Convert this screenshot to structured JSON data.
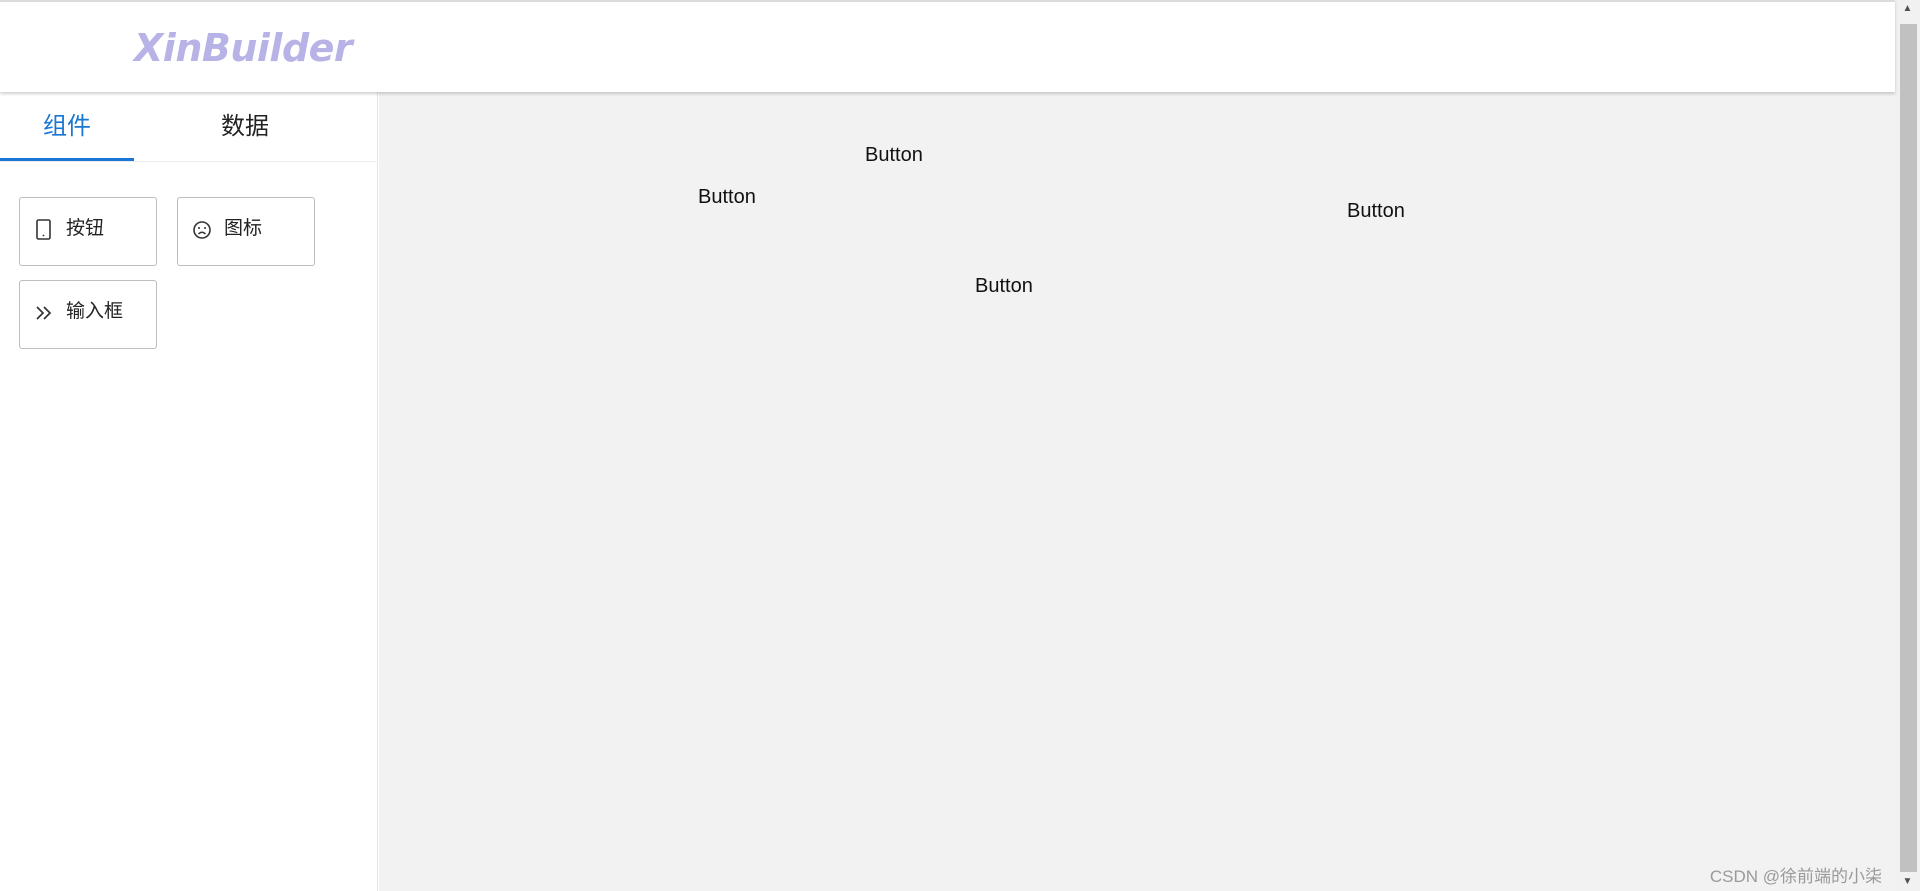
{
  "header": {
    "logo": "XinBuilder"
  },
  "sidebar": {
    "tabs": [
      {
        "label": "组件",
        "active": true
      },
      {
        "label": "数据",
        "active": false
      }
    ],
    "components": [
      {
        "label": "按钮",
        "icon": "tablet-icon"
      },
      {
        "label": "图标",
        "icon": "frown-icon"
      },
      {
        "label": "输入框",
        "icon": "double-chevron-right-icon"
      }
    ]
  },
  "canvas": {
    "buttons": [
      "Button",
      "Button",
      "Button",
      "Button"
    ]
  },
  "watermark": "CSDN @徐前端的小柒",
  "colors": {
    "accent": "#1976d2",
    "logo": "#b7b3e6",
    "canvas_bg": "#f2f2f2"
  }
}
